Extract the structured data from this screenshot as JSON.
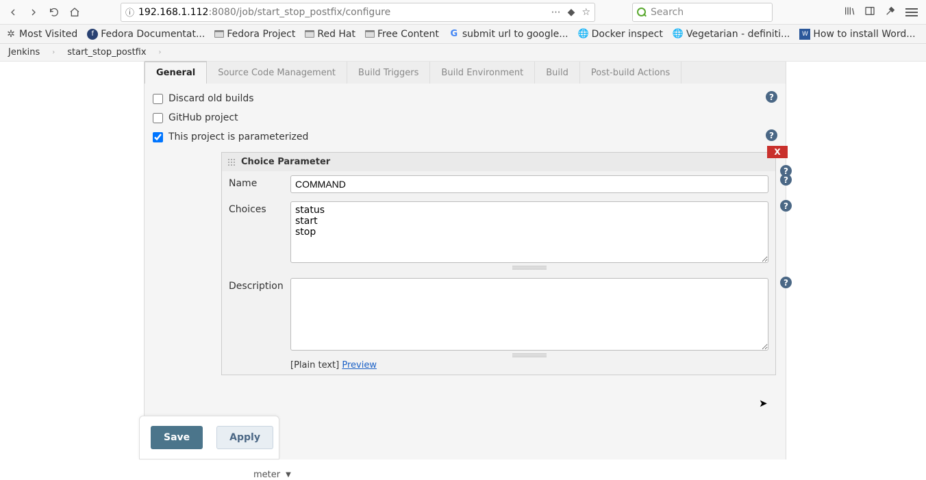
{
  "browser": {
    "url_host": "192.168.1.112",
    "url_path": ":8080/job/start_stop_postfix/configure",
    "search_placeholder": "Search"
  },
  "bookmarks": [
    {
      "label": "Most Visited",
      "icon": "gear"
    },
    {
      "label": "Fedora Documentat...",
      "icon": "fedora"
    },
    {
      "label": "Fedora Project",
      "icon": "folder"
    },
    {
      "label": "Red Hat",
      "icon": "folder"
    },
    {
      "label": "Free Content",
      "icon": "folder"
    },
    {
      "label": "submit url to google...",
      "icon": "google"
    },
    {
      "label": "Docker inspect",
      "icon": "globe"
    },
    {
      "label": "Vegetarian - definiti...",
      "icon": "globe"
    },
    {
      "label": "How to install Word...",
      "icon": "doc"
    }
  ],
  "breadcrumb": {
    "root": "Jenkins",
    "job": "start_stop_postfix"
  },
  "tabs": [
    "General",
    "Source Code Management",
    "Build Triggers",
    "Build Environment",
    "Build",
    "Post-build Actions"
  ],
  "checks": {
    "discard": "Discard old builds",
    "github": "GitHub project",
    "param": "This project is parameterized"
  },
  "parameter": {
    "title": "Choice Parameter",
    "delete": "X",
    "name_label": "Name",
    "name_value": "COMMAND",
    "choices_label": "Choices",
    "choices_value": "status\nstart\nstop",
    "desc_label": "Description",
    "desc_value": "",
    "plain": "[Plain text]",
    "preview": "Preview"
  },
  "add_param_label": "meter",
  "buttons": {
    "save": "Save",
    "apply": "Apply"
  },
  "help": "?"
}
